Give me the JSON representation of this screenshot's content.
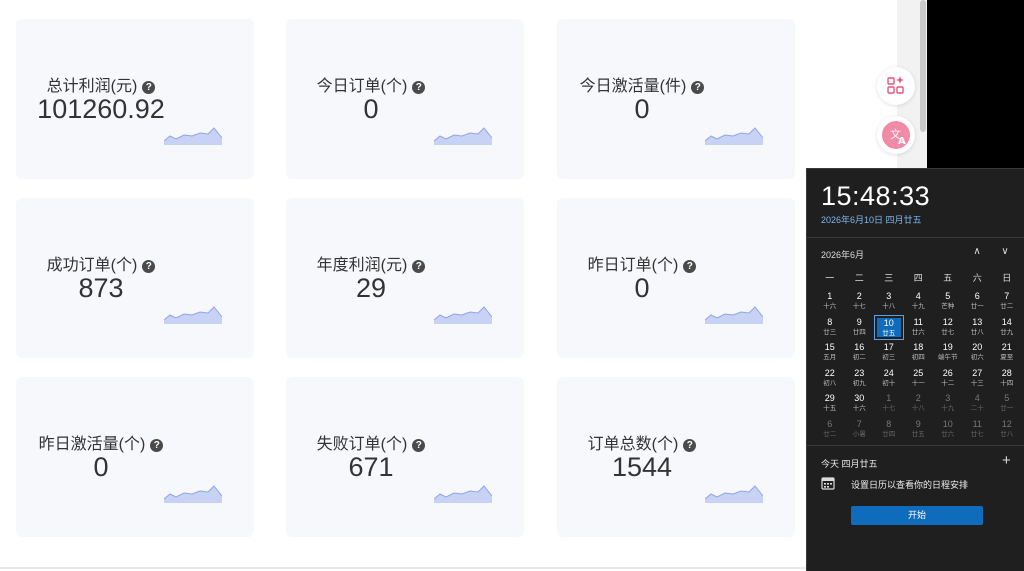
{
  "cards": [
    {
      "title": "总计利润(元)",
      "value": "101260.92"
    },
    {
      "title": "今日订单(个)",
      "value": "0"
    },
    {
      "title": "今日激活量(件)",
      "value": "0"
    },
    {
      "title": "成功订单(个)",
      "value": "873"
    },
    {
      "title": "年度利润(元)",
      "value": "29"
    },
    {
      "title": "昨日订单(个)",
      "value": "0"
    },
    {
      "title": "昨日激活量(个)",
      "value": "0"
    },
    {
      "title": "失败订单(个)",
      "value": "671"
    },
    {
      "title": "订单总数(个)",
      "value": "1544"
    }
  ],
  "help_icon_char": "?",
  "icons": {
    "help": "question-circle-icon",
    "grid_sparkle": "grid-sparkle-icon",
    "translate": "translate-icon",
    "calendar": "calendar-icon",
    "up": "chevron-up-icon",
    "down": "chevron-down-icon",
    "add": "plus-icon"
  },
  "colors": {
    "sparkline_fill": "#c7d2f5",
    "sparkline_stroke": "#8fa4ea",
    "accent_blue": "#0f6cbd",
    "translate_pink": "#e8527a"
  },
  "clock": {
    "time": "15:48:33",
    "full_date": "2026年6月10日 四月廿五",
    "month_label": "2026年6月",
    "nav_up": "∧",
    "nav_down": "∨",
    "weekdays": [
      "一",
      "二",
      "三",
      "四",
      "五",
      "六",
      "日"
    ],
    "weeks": [
      [
        {
          "d": "1",
          "s": "十六"
        },
        {
          "d": "2",
          "s": "十七"
        },
        {
          "d": "3",
          "s": "十八"
        },
        {
          "d": "4",
          "s": "十九"
        },
        {
          "d": "5",
          "s": "芒种"
        },
        {
          "d": "6",
          "s": "廿一"
        },
        {
          "d": "7",
          "s": "廿二"
        }
      ],
      [
        {
          "d": "8",
          "s": "廿三"
        },
        {
          "d": "9",
          "s": "廿四"
        },
        {
          "d": "10",
          "s": "廿五",
          "today": true
        },
        {
          "d": "11",
          "s": "廿六"
        },
        {
          "d": "12",
          "s": "廿七"
        },
        {
          "d": "13",
          "s": "廿八"
        },
        {
          "d": "14",
          "s": "廿九"
        }
      ],
      [
        {
          "d": "15",
          "s": "五月"
        },
        {
          "d": "16",
          "s": "初二"
        },
        {
          "d": "17",
          "s": "初三"
        },
        {
          "d": "18",
          "s": "初四"
        },
        {
          "d": "19",
          "s": "端午节"
        },
        {
          "d": "20",
          "s": "初六"
        },
        {
          "d": "21",
          "s": "夏至"
        }
      ],
      [
        {
          "d": "22",
          "s": "初八"
        },
        {
          "d": "23",
          "s": "初九"
        },
        {
          "d": "24",
          "s": "初十"
        },
        {
          "d": "25",
          "s": "十一"
        },
        {
          "d": "26",
          "s": "十二"
        },
        {
          "d": "27",
          "s": "十三"
        },
        {
          "d": "28",
          "s": "十四"
        }
      ],
      [
        {
          "d": "29",
          "s": "十五"
        },
        {
          "d": "30",
          "s": "十六"
        },
        {
          "d": "1",
          "s": "十七",
          "other": true
        },
        {
          "d": "2",
          "s": "十八",
          "other": true
        },
        {
          "d": "3",
          "s": "十九",
          "other": true
        },
        {
          "d": "4",
          "s": "二十",
          "other": true
        },
        {
          "d": "5",
          "s": "廿一",
          "other": true
        }
      ],
      [
        {
          "d": "6",
          "s": "廿二",
          "other": true
        },
        {
          "d": "7",
          "s": "小暑",
          "other": true
        },
        {
          "d": "8",
          "s": "廿四",
          "other": true
        },
        {
          "d": "9",
          "s": "廿五",
          "other": true
        },
        {
          "d": "10",
          "s": "廿六",
          "other": true
        },
        {
          "d": "11",
          "s": "廿七",
          "other": true
        },
        {
          "d": "12",
          "s": "廿八",
          "other": true
        }
      ]
    ],
    "agenda_title": "今天 四月廿五",
    "agenda_add": "+",
    "agenda_text": "设置日历以查看你的日程安排",
    "start_label": "开始"
  }
}
